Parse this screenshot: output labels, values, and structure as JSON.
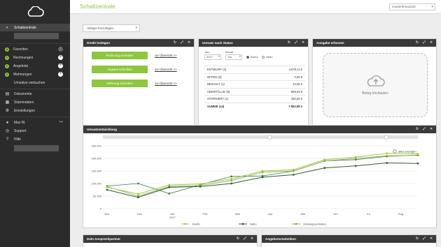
{
  "app": {
    "title": "Schaltzentrale",
    "account": "musterfirma1234"
  },
  "sidebar": {
    "items": [
      {
        "label": "Schaltzentrale",
        "icon": "dashboard-icon"
      },
      {
        "label": "Favoriten",
        "icon": "star-icon"
      },
      {
        "label": "Rechnungen",
        "icon": "invoice-icon"
      },
      {
        "label": "Angebote",
        "icon": "offer-icon"
      },
      {
        "label": "Mahnungen",
        "icon": "reminder-icon"
      },
      {
        "label": "Umsätze verbuchen",
        "icon": ""
      },
      {
        "label": "Dokumente",
        "icon": "document-icon"
      },
      {
        "label": "Stammdaten",
        "icon": "database-icon"
      },
      {
        "label": "Einstellungen",
        "icon": "settings-icon"
      },
      {
        "label": "Max M.",
        "icon": "user-icon"
      },
      {
        "label": "Support",
        "icon": "support-icon"
      },
      {
        "label": "Hilfe",
        "icon": "help-icon"
      }
    ]
  },
  "widgets": {
    "add_placeholder": "- Widget hinzufügen -"
  },
  "direct": {
    "title": "Direkt loslegen",
    "buttons": [
      "Rechnung schreiben",
      "Angebot schreiben",
      "Mahnung schreiben"
    ],
    "link": "zur Übersicht >>"
  },
  "status": {
    "title": "Umsatz nach Status",
    "year_label": "Jahr",
    "month_label": "Monat",
    "year": "2017",
    "month": "Okt",
    "brutto": "Brutto",
    "netto": "Netto",
    "rows": [
      {
        "label": "ENTWURF",
        "count": "(3)",
        "value": "4.579,11 €"
      },
      {
        "label": "OFFEN",
        "count": "(0)",
        "value": "0,00 €"
      },
      {
        "label": "BEZAHLT",
        "count": "(1)",
        "value": "13,65 €"
      },
      {
        "label": "ÜBERFÄLLIG",
        "count": "(9)",
        "value": "809,03 €"
      },
      {
        "label": "STORNIERT",
        "count": "(1)",
        "value": "330,00 €"
      },
      {
        "label": "SUMME",
        "count": "(14)",
        "value": "7.852,89 €"
      }
    ]
  },
  "expenses": {
    "title": "Ausgabe erfassen",
    "upload_label": "Beleg hochladen"
  },
  "chart_panel": {
    "title": "Umsatzentwicklung",
    "show_all": "alles anzeigen"
  },
  "chart_data": {
    "type": "line",
    "categories": [
      "Nov",
      "Dez",
      "Jan",
      "Feb",
      "Mär",
      "Apr",
      "Mai",
      "Jun",
      "Jul",
      "Aug"
    ],
    "x_sub_label": "2017",
    "ylim": [
      0,
      250000
    ],
    "yticks": [
      "0",
      "50.000",
      "100.000",
      "150.000",
      "200.000",
      "250.000"
    ],
    "series": [
      {
        "name": "Brutto",
        "color": "#9ccc3c",
        "values": [
          85000,
          58000,
          94000,
          98000,
          118000,
          150000,
          155000,
          195000,
          205000,
          220000,
          218000
        ]
      },
      {
        "name": "Netto",
        "color": "#2e5e2e",
        "values": [
          75000,
          45000,
          85000,
          88000,
          100000,
          125000,
          135000,
          162000,
          170000,
          182000,
          180000
        ]
      },
      {
        "name": "Zahlungsverhalten",
        "color": "#8aa34a",
        "values": [
          88000,
          50000,
          88000,
          92000,
          112000,
          145000,
          150000,
          190000,
          200000,
          210000,
          212000
        ]
      }
    ],
    "alt_series": {
      "name": "",
      "values": [
        90000,
        100000,
        60000,
        95000,
        128000,
        130000,
        150000,
        190000,
        195000,
        208000,
        213000
      ]
    }
  },
  "bottom": {
    "contacts_title": "Dein Ansprechpartner",
    "stats_title": "Angebotsstatistiken"
  }
}
